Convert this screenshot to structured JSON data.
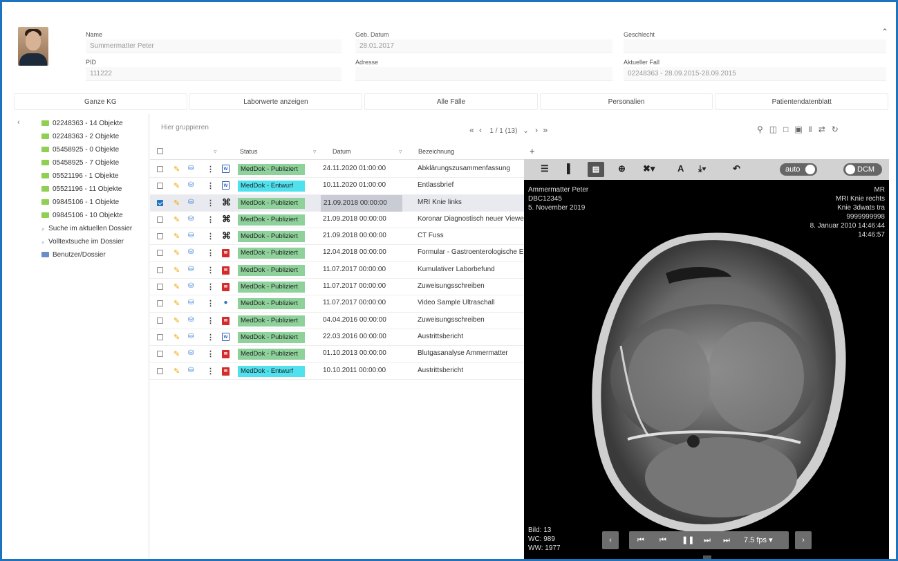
{
  "patient": {
    "name_label": "Name",
    "name_value": "Summermatter Peter",
    "dob_label": "Geb. Datum",
    "dob_value": "28.01.2017",
    "gender_label": "Geschlecht",
    "gender_value": "",
    "pid_label": "PID",
    "pid_value": "111222",
    "address_label": "Adresse",
    "address_value": "",
    "case_label": "Aktueller Fall",
    "case_value": "02248363 - 28.09.2015-28.09.2015"
  },
  "tabs": [
    "Ganze KG",
    "Laborwerte anzeigen",
    "Alle Fälle",
    "Personalien",
    "Patientendatenblatt"
  ],
  "sidebar": {
    "items": [
      {
        "label": "02248363 - 14 Objekte",
        "icon": "folder-icon"
      },
      {
        "label": "02248363 - 2 Objekte",
        "icon": "folder-icon"
      },
      {
        "label": "05458925 - 0 Objekte",
        "icon": "folder-icon"
      },
      {
        "label": "05458925 - 7 Objekte",
        "icon": "folder-icon"
      },
      {
        "label": "05521196 - 1 Objekte",
        "icon": "folder-icon"
      },
      {
        "label": "05521196 - 11 Objekte",
        "icon": "folder-icon"
      },
      {
        "label": "09845106 - 1 Objekte",
        "icon": "folder-icon"
      },
      {
        "label": "09845106 - 10 Objekte",
        "icon": "folder-icon"
      },
      {
        "label": "Suche im aktuellen Dossier",
        "icon": "search-icon"
      },
      {
        "label": "Volltextsuche im Dossier",
        "icon": "search-icon"
      },
      {
        "label": "Benutzer/Dossier",
        "icon": "user-icon"
      }
    ]
  },
  "list": {
    "group_placeholder": "Hier gruppieren",
    "pagination": "1 / 1 (13)",
    "columns": {
      "status": "Status",
      "datum": "Datum",
      "bezeichnung": "Bezeichnung"
    },
    "rows": [
      {
        "status": "MedDok - Publiziert",
        "kind": "pub",
        "doc": "word",
        "datum": "24.11.2020 01:00:00",
        "bez": "Abklärungszusammenfassung",
        "selected": false
      },
      {
        "status": "MedDok - Entwurf",
        "kind": "ent",
        "doc": "word",
        "datum": "10.11.2020 01:00:00",
        "bez": "Entlassbrief",
        "selected": false
      },
      {
        "status": "MedDok - Publiziert",
        "kind": "pub",
        "doc": "xray",
        "datum": "21.09.2018 00:00:00",
        "bez": "MRI Knie links",
        "selected": true
      },
      {
        "status": "MedDok - Publiziert",
        "kind": "pub",
        "doc": "xray",
        "datum": "21.09.2018 00:00:00",
        "bez": "Koronar Diagnostisch neuer Viewe",
        "selected": false
      },
      {
        "status": "MedDok - Publiziert",
        "kind": "pub",
        "doc": "xray",
        "datum": "21.09.2018 00:00:00",
        "bez": "CT Fuss",
        "selected": false
      },
      {
        "status": "MedDok - Publiziert",
        "kind": "pub",
        "doc": "pdf",
        "datum": "12.04.2018 00:00:00",
        "bez": "Formular - Gastroenterologische E",
        "selected": false
      },
      {
        "status": "MedDok - Publiziert",
        "kind": "pub",
        "doc": "pdf",
        "datum": "11.07.2017 00:00:00",
        "bez": "Kumulativer Laborbefund",
        "selected": false
      },
      {
        "status": "MedDok - Publiziert",
        "kind": "pub",
        "doc": "pdf",
        "datum": "11.07.2017 00:00:00",
        "bez": "Zuweisungsschreiben",
        "selected": false
      },
      {
        "status": "MedDok - Publiziert",
        "kind": "pub",
        "doc": "video",
        "datum": "11.07.2017 00:00:00",
        "bez": "Video Sample Ultraschall",
        "selected": false
      },
      {
        "status": "MedDok - Publiziert",
        "kind": "pub",
        "doc": "pdf",
        "datum": "04.04.2016 00:00:00",
        "bez": "Zuweisungsschreiben",
        "selected": false
      },
      {
        "status": "MedDok - Publiziert",
        "kind": "pub",
        "doc": "word",
        "datum": "22.03.2016 00:00:00",
        "bez": "Austrittsbericht",
        "selected": false
      },
      {
        "status": "MedDok - Publiziert",
        "kind": "pub",
        "doc": "pdf",
        "datum": "01.10.2013 00:00:00",
        "bez": "Blutgasanalyse Ammermatter",
        "selected": false
      },
      {
        "status": "MedDok - Entwurf",
        "kind": "ent",
        "doc": "pdf",
        "datum": "10.10.2011 00:00:00",
        "bez": "Austrittsbericht",
        "selected": false
      }
    ]
  },
  "viewer": {
    "toggle_auto": "auto",
    "toggle_dcm": "DCM",
    "overlay_tl": [
      "Ammermatter Peter",
      "DBC12345",
      "5. November 2019"
    ],
    "overlay_tr": [
      "MR",
      "MRI Knie rechts",
      "Knie 3dwats tra",
      "9999999998",
      "8. Januar 2010 14:46:44",
      "14:46:57"
    ],
    "overlay_bl": [
      "Bild: 13",
      "WC: 989",
      "WW: 1977"
    ],
    "fps": "7.5 fps"
  }
}
